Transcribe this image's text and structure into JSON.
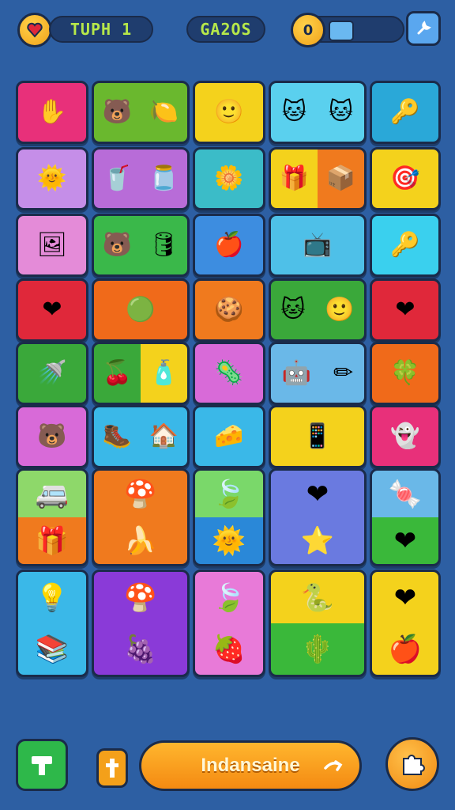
{
  "hud": {
    "left_badge_icon": "heart-check-icon",
    "counter_left": "TUPH 1",
    "counter_center": "GA2OS",
    "coin_value": "0",
    "toggle_icon": "square-icon",
    "settings_icon": "wrench-icon"
  },
  "tiles": [
    {
      "name": "tile-glove",
      "colors": [
        "#e8307a"
      ],
      "icons": [
        "glove"
      ]
    },
    {
      "name": "tile-bear-lemon",
      "colors": [
        "#6ab82e"
      ],
      "icons": [
        "bear",
        "lemon"
      ]
    },
    {
      "name": "tile-face-hat",
      "colors": [
        "#f4d21c"
      ],
      "icons": [
        "face"
      ]
    },
    {
      "name": "tile-cats",
      "colors": [
        "#5ad0ee"
      ],
      "icons": [
        "cat",
        "cat"
      ]
    },
    {
      "name": "tile-key",
      "colors": [
        "#2aa8d8"
      ],
      "icons": [
        "key"
      ]
    },
    {
      "name": "tile-sun",
      "colors": [
        "#c58ee8"
      ],
      "icons": [
        "sun"
      ]
    },
    {
      "name": "tile-cup-jar",
      "colors": [
        "#b86cd8"
      ],
      "icons": [
        "cup",
        "jar"
      ]
    },
    {
      "name": "tile-flower-face",
      "colors": [
        "#3bbcc8"
      ],
      "icons": [
        "flower"
      ]
    },
    {
      "name": "tile-gift-box",
      "colors": [
        "#f4d21c",
        "#f07a1e"
      ],
      "icons": [
        "gift",
        "box"
      ]
    },
    {
      "name": "tile-target",
      "colors": [
        "#f4d21c"
      ],
      "icons": [
        "target"
      ]
    },
    {
      "name": "tile-frame",
      "colors": [
        "#e48bd8"
      ],
      "icons": [
        "frame"
      ]
    },
    {
      "name": "tile-bear-barrel",
      "colors": [
        "#3ab84a"
      ],
      "icons": [
        "bear",
        "barrel"
      ]
    },
    {
      "name": "tile-apple",
      "colors": [
        "#3d8de0"
      ],
      "icons": [
        "apple"
      ]
    },
    {
      "name": "tile-tv",
      "colors": [
        "#4ec0e8"
      ],
      "icons": [
        "tv"
      ]
    },
    {
      "name": "tile-key2",
      "colors": [
        "#3ad0ee"
      ],
      "icons": [
        "key"
      ]
    },
    {
      "name": "tile-heart-bag",
      "colors": [
        "#e0283a"
      ],
      "icons": [
        "heart"
      ]
    },
    {
      "name": "tile-blob",
      "colors": [
        "#f06a1a"
      ],
      "icons": [
        "blob"
      ]
    },
    {
      "name": "tile-cookie",
      "colors": [
        "#f07a1e"
      ],
      "icons": [
        "cookie"
      ]
    },
    {
      "name": "tile-cat-face",
      "colors": [
        "#3aa83a"
      ],
      "icons": [
        "cat",
        "face"
      ]
    },
    {
      "name": "tile-heart",
      "colors": [
        "#e0283a"
      ],
      "icons": [
        "heart"
      ]
    },
    {
      "name": "tile-watering-can",
      "colors": [
        "#3aa83a"
      ],
      "icons": [
        "can"
      ]
    },
    {
      "name": "tile-cherry-bottle",
      "colors": [
        "#3aa83a",
        "#f4d21c"
      ],
      "icons": [
        "cherry",
        "bottle"
      ]
    },
    {
      "name": "tile-germ",
      "colors": [
        "#d86ad8"
      ],
      "icons": [
        "germ"
      ]
    },
    {
      "name": "tile-robot-pencil",
      "colors": [
        "#6ab8e8"
      ],
      "icons": [
        "robot",
        "pencil"
      ]
    },
    {
      "name": "tile-clover",
      "colors": [
        "#f06a1a"
      ],
      "icons": [
        "clover"
      ]
    },
    {
      "name": "tile-bear-face",
      "colors": [
        "#d86ad8"
      ],
      "icons": [
        "bear"
      ]
    },
    {
      "name": "tile-boot-house",
      "colors": [
        "#3ab8e8"
      ],
      "icons": [
        "boot",
        "house"
      ]
    },
    {
      "name": "tile-cheese",
      "colors": [
        "#3ab8e8"
      ],
      "icons": [
        "cheese"
      ]
    },
    {
      "name": "tile-tablet",
      "colors": [
        "#f4d21c"
      ],
      "icons": [
        "tablet"
      ]
    },
    {
      "name": "tile-ghost",
      "colors": [
        "#e8307a"
      ],
      "icons": [
        "ghost"
      ]
    },
    {
      "name": "tile-van-gift",
      "colors": [
        "#8ed86a",
        "#f07a1e"
      ],
      "icons": [
        "van",
        "gift"
      ]
    },
    {
      "name": "tile-mushroom-banana",
      "colors": [
        "#f07a1e"
      ],
      "icons": [
        "mushroom",
        "banana"
      ]
    },
    {
      "name": "tile-leaf-sun",
      "colors": [
        "#7ad86a",
        "#2a88d8"
      ],
      "icons": [
        "leaf",
        "sun"
      ]
    },
    {
      "name": "tile-heart-star",
      "colors": [
        "#6a7ae0"
      ],
      "icons": [
        "heart",
        "star"
      ]
    },
    {
      "name": "tile-candy-heart",
      "colors": [
        "#6ab8e8",
        "#3ab83a"
      ],
      "icons": [
        "candy",
        "heart"
      ]
    },
    {
      "name": "tile-lamp-book",
      "colors": [
        "#3ab8e8"
      ],
      "icons": [
        "lamp",
        "book"
      ]
    },
    {
      "name": "tile-mushroom-grape",
      "colors": [
        "#8a3ad8"
      ],
      "icons": [
        "mushroom",
        "grape"
      ]
    },
    {
      "name": "tile-leaf-berry",
      "colors": [
        "#e87ad8"
      ],
      "icons": [
        "leaf",
        "berry"
      ]
    },
    {
      "name": "tile-snake-cactus",
      "colors": [
        "#f4d21c",
        "#3ab83a"
      ],
      "icons": [
        "snake",
        "cactus"
      ]
    },
    {
      "name": "tile-heart-apple",
      "colors": [
        "#f4d21c"
      ],
      "icons": [
        "heart",
        "apple"
      ]
    }
  ],
  "bottom": {
    "left_button_icon": "hammer-icon",
    "small_button_icon": "cross-icon",
    "play_label": "Indansaine",
    "play_icon": "arrow-icon",
    "right_button_icon": "puzzle-icon"
  }
}
